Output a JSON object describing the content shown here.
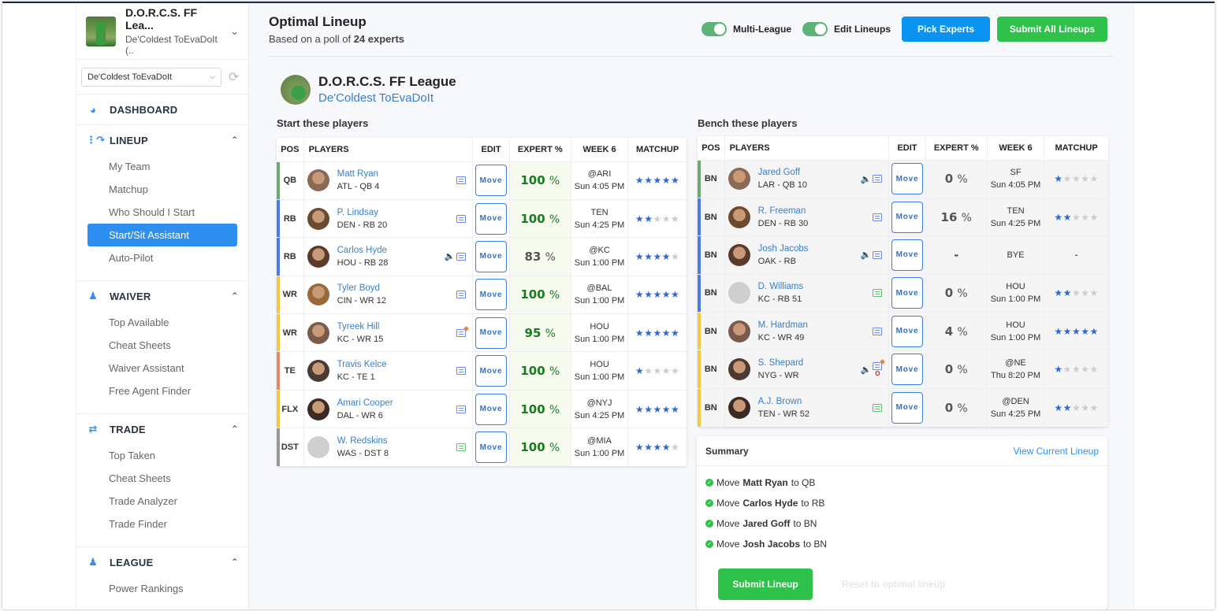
{
  "sidebar": {
    "league_name": "D.O.R.C.S. FF Lea...",
    "team_name": "De'Coldest ToEvaDoIt (..",
    "team_select": "De'Coldest ToEvaDoIt",
    "sections": [
      {
        "label": "DASHBOARD",
        "icon": "gauge-icon",
        "items": []
      },
      {
        "label": "LINEUP",
        "icon": "lineup-icon",
        "items": [
          "My Team",
          "Matchup",
          "Who Should I Start",
          "Start/Sit Assistant",
          "Auto-Pilot"
        ],
        "active": "Start/Sit Assistant"
      },
      {
        "label": "WAIVER",
        "icon": "users-search-icon",
        "items": [
          "Top Available",
          "Cheat Sheets",
          "Waiver Assistant",
          "Free Agent Finder"
        ]
      },
      {
        "label": "TRADE",
        "icon": "swap-arrows-icon",
        "items": [
          "Top Taken",
          "Cheat Sheets",
          "Trade Analyzer",
          "Trade Finder"
        ]
      },
      {
        "label": "LEAGUE",
        "icon": "league-user-icon",
        "items": [
          "Power Rankings"
        ]
      }
    ]
  },
  "header": {
    "title": "Optimal Lineup",
    "subtitle_prefix": "Based on a poll of",
    "subtitle_bold": "24 experts",
    "toggle_multi_league": "Multi-League",
    "toggle_edit_lineups": "Edit Lineups",
    "pick_experts": "Pick Experts",
    "submit_all": "Submit All Lineups"
  },
  "team": {
    "league": "D.O.R.C.S. FF League",
    "name": "De'Coldest ToEvaDoIt"
  },
  "start_section": {
    "title": "Start these players",
    "columns": [
      "POS",
      "PLAYERS",
      "EDIT",
      "EXPERT %",
      "WEEK 6",
      "MATCHUP"
    ],
    "rows": [
      {
        "pos": "QB",
        "name": "Matt Ryan",
        "meta": "ATL - QB 4",
        "pct": "100",
        "opp": "@ARI",
        "time": "Sun 4:05 PM",
        "stars": 5,
        "audio": false,
        "note": "blue"
      },
      {
        "pos": "RB",
        "name": "P. Lindsay",
        "meta": "DEN - RB 20",
        "pct": "100",
        "opp": "TEN",
        "time": "Sun 4:25 PM",
        "stars": 2,
        "audio": false,
        "note": "blue"
      },
      {
        "pos": "RB",
        "name": "Carlos Hyde",
        "meta": "HOU - RB 28",
        "pct": "83",
        "opp": "@KC",
        "time": "Sun 1:00 PM",
        "stars": 4,
        "audio": true,
        "note": "blue"
      },
      {
        "pos": "WR",
        "name": "Tyler Boyd",
        "meta": "CIN - WR 12",
        "pct": "100",
        "opp": "@BAL",
        "time": "Sun 1:00 PM",
        "stars": 5,
        "audio": false,
        "note": "blue"
      },
      {
        "pos": "WR",
        "name": "Tyreek Hill",
        "meta": "KC - WR 15",
        "pct": "95",
        "opp": "HOU",
        "time": "Sun 1:00 PM",
        "stars": 5,
        "audio": false,
        "note": "alert"
      },
      {
        "pos": "TE",
        "name": "Travis Kelce",
        "meta": "KC - TE 1",
        "pct": "100",
        "opp": "HOU",
        "time": "Sun 1:00 PM",
        "stars": 1,
        "audio": false,
        "note": "blue"
      },
      {
        "pos": "FLX",
        "name": "Amari Cooper",
        "meta": "DAL - WR 6",
        "pct": "100",
        "opp": "@NYJ",
        "time": "Sun 4:25 PM",
        "stars": 5,
        "audio": false,
        "note": "blue"
      },
      {
        "pos": "DST",
        "name": "W. Redskins",
        "meta": "WAS - DST 8",
        "pct": "100",
        "opp": "@MIA",
        "time": "Sun 1:00 PM",
        "stars": 4,
        "audio": false,
        "note": "green"
      }
    ]
  },
  "bench_section": {
    "title": "Bench these players",
    "columns": [
      "POS",
      "PLAYERS",
      "EDIT",
      "EXPERT %",
      "WEEK 6",
      "MATCHUP"
    ],
    "rows": [
      {
        "pos": "BN",
        "name": "Jared Goff",
        "meta": "LAR - QB 10",
        "pct": "0",
        "opp": "SF",
        "time": "Sun 4:05 PM",
        "stars": 1,
        "audio": true,
        "note": "blue",
        "slot": "QB"
      },
      {
        "pos": "BN",
        "name": "R. Freeman",
        "meta": "DEN - RB 30",
        "pct": "16",
        "opp": "TEN",
        "time": "Sun 4:25 PM",
        "stars": 2,
        "audio": false,
        "note": "blue",
        "slot": "RB"
      },
      {
        "pos": "BN",
        "name": "Josh Jacobs",
        "meta": "OAK - RB",
        "pct": "-",
        "opp": "BYE",
        "time": "",
        "stars": null,
        "audio": true,
        "note": "blue",
        "slot": "RB"
      },
      {
        "pos": "BN",
        "name": "D. Williams",
        "meta": "KC - RB 51",
        "pct": "0",
        "opp": "HOU",
        "time": "Sun 1:00 PM",
        "stars": 2,
        "audio": false,
        "note": "green",
        "slot": "RB"
      },
      {
        "pos": "BN",
        "name": "M. Hardman",
        "meta": "KC - WR 49",
        "pct": "4",
        "opp": "HOU",
        "time": "Sun 1:00 PM",
        "stars": 5,
        "audio": false,
        "note": "blue",
        "slot": "WR"
      },
      {
        "pos": "BN",
        "name": "S. Shepard",
        "meta": "NYG - WR",
        "pct": "0",
        "opp": "@NE",
        "time": "Thu 8:20 PM",
        "stars": 1,
        "audio": true,
        "note": "alert",
        "injury": "O",
        "slot": "WR"
      },
      {
        "pos": "BN",
        "name": "A.J. Brown",
        "meta": "TEN - WR 52",
        "pct": "0",
        "opp": "@DEN",
        "time": "Sun 4:25 PM",
        "stars": 2,
        "audio": false,
        "note": "green",
        "slot": "WR"
      }
    ]
  },
  "move_label": "Move",
  "dash": "-",
  "summary": {
    "title": "Summary",
    "view_current": "View Current Lineup",
    "items": [
      {
        "prefix": "Move",
        "player": "Matt Ryan",
        "suffix": "to QB"
      },
      {
        "prefix": "Move",
        "player": "Carlos Hyde",
        "suffix": "to RB"
      },
      {
        "prefix": "Move",
        "player": "Jared Goff",
        "suffix": "to BN"
      },
      {
        "prefix": "Move",
        "player": "Josh Jacobs",
        "suffix": "to BN"
      }
    ],
    "submit": "Submit Lineup",
    "reset": "Reset to optimal lineup"
  },
  "colors": {
    "QB": "#6fa872",
    "RB": "#4a7de8",
    "WR": "#f5c842",
    "TE": "#e08a6a",
    "FLX": "#f5c842",
    "DST": "#999999",
    "accent_blue": "#0a93f0",
    "accent_green": "#2ec24a",
    "star": "#2f68d1"
  }
}
